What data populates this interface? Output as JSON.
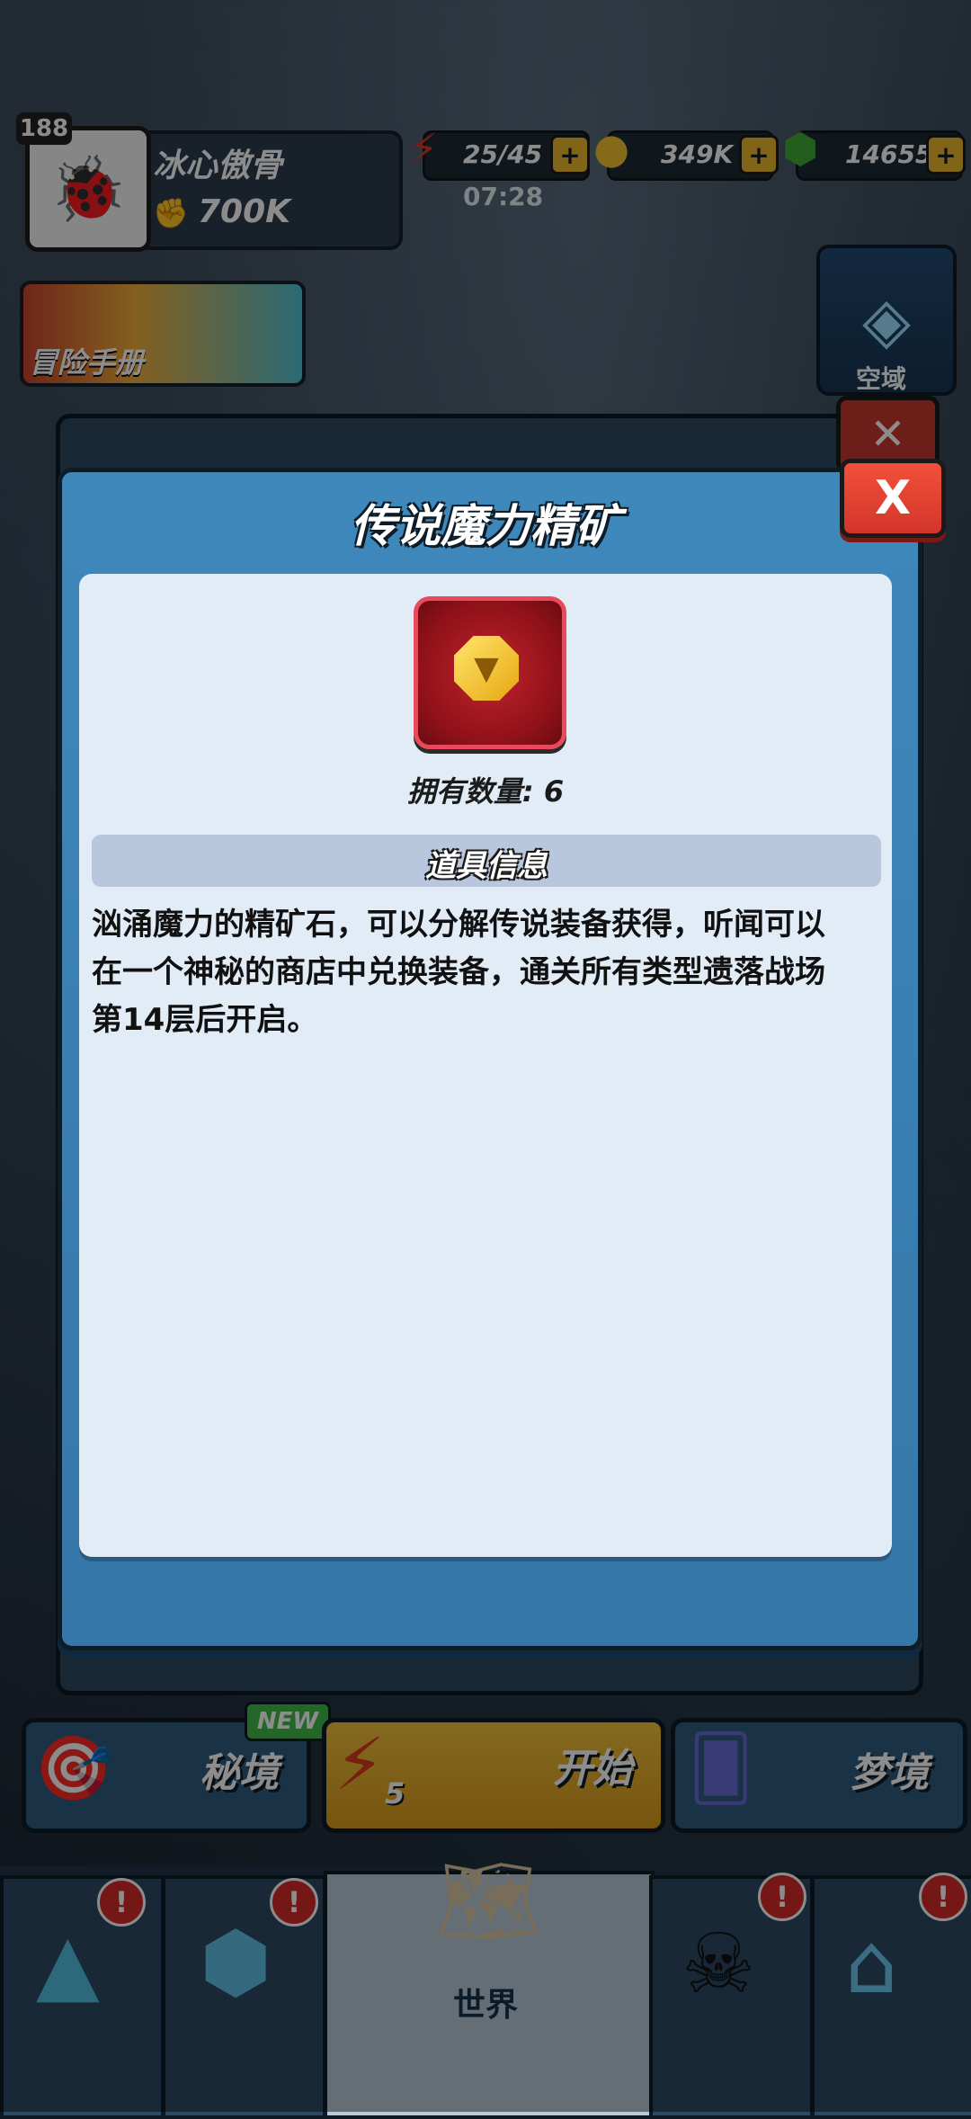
{
  "hud": {
    "level": "188",
    "player_name": "冰心傲骨",
    "power": "700K",
    "energy": "25/45",
    "energy_timer": "07:28",
    "coins": "349K",
    "gems": "14655",
    "plus": "+"
  },
  "adventure_manual": {
    "label": "冒险手册"
  },
  "airspace": {
    "label": "空域"
  },
  "modal": {
    "title": "传说魔力精矿",
    "close": "X",
    "owned_label": "拥有数量: 6",
    "info_header": "道具信息",
    "description": "汹涌魔力的精矿石，可以分解传说装备获得，听闻可以在一个神秘的商店中兑换装备，通关所有类型遗落战场第14层后开启。"
  },
  "actions": {
    "secret_realm": "秘境",
    "new_badge": "NEW",
    "start": "开始",
    "energy_cost": "5",
    "dreamland": "梦境"
  },
  "nav": {
    "world_label": "世界",
    "alert": "!"
  },
  "colors": {
    "modal_blue": "#3f88bc",
    "close_red": "#d2352a",
    "start_yellow": "#f1c13c"
  }
}
